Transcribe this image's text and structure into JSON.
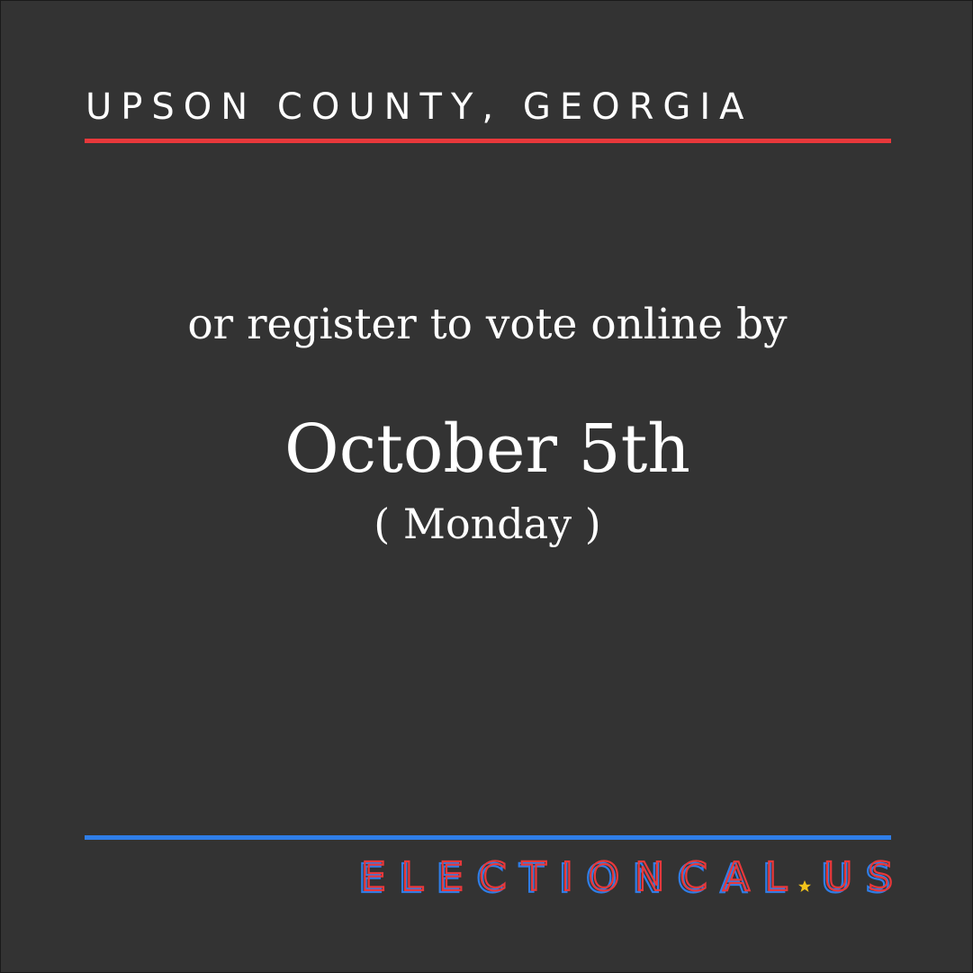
{
  "header": {
    "location": "UPSON COUNTY, GEORGIA"
  },
  "message": {
    "line1": "or register to vote online by",
    "date": "October 5th",
    "weekday": "( Monday )"
  },
  "logo": {
    "text": "ELECTIONCAL.US",
    "main": "ELECTIONCAL",
    "suffix": "US"
  },
  "colors": {
    "background": "#333333",
    "accent_red": "#e8383b",
    "accent_blue": "#2f7ee8",
    "star": "#f2c31b",
    "text": "#ffffff"
  },
  "icons": {
    "logo_dot": "star-icon"
  }
}
